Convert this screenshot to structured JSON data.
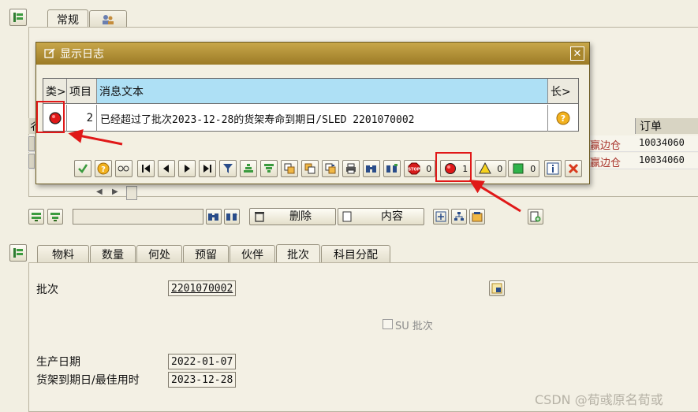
{
  "top_tabs": [
    {
      "label": "常规"
    }
  ],
  "dialog": {
    "title": "显示日志",
    "close_label": "✕",
    "columns": {
      "type": "类>",
      "item": "项目",
      "message": "消息文本",
      "long": "长>"
    },
    "row": {
      "item": "2",
      "message": "已经超过了批次2023-12-28的货架寿命到期日/SLED 2201070002"
    },
    "counts": {
      "stop": "0",
      "error": "1",
      "warning": "0",
      "success": "0"
    }
  },
  "bg_table": {
    "header_order": "订单",
    "header_partial": "彳",
    "rows": [
      {
        "warehouse": "赢边仓",
        "order": "10034060"
      },
      {
        "warehouse": "赢边仓",
        "order": "10034060"
      }
    ]
  },
  "toolbar2": {
    "delete_label": "删除",
    "content_label": "内容"
  },
  "detail_tabs": [
    {
      "label": "物料"
    },
    {
      "label": "数量"
    },
    {
      "label": "何处"
    },
    {
      "label": "预留"
    },
    {
      "label": "伙伴"
    },
    {
      "label": "批次"
    },
    {
      "label": "科目分配"
    }
  ],
  "detail": {
    "batch_label": "批次",
    "batch_value": "2201070002",
    "su_batch_label": "SU 批次",
    "prod_date_label": "生产日期",
    "prod_date_value": "2022-01-07",
    "sled_label": "货架到期日/最佳用时",
    "sled_value": "2023-12-28"
  },
  "watermark": "CSDN @荀彧原名荀或",
  "colors": {
    "title_bar": "#b3922f",
    "error_red": "#e01818",
    "header_blue": "#aee0f5",
    "warehouse_red": "#a8322a"
  }
}
